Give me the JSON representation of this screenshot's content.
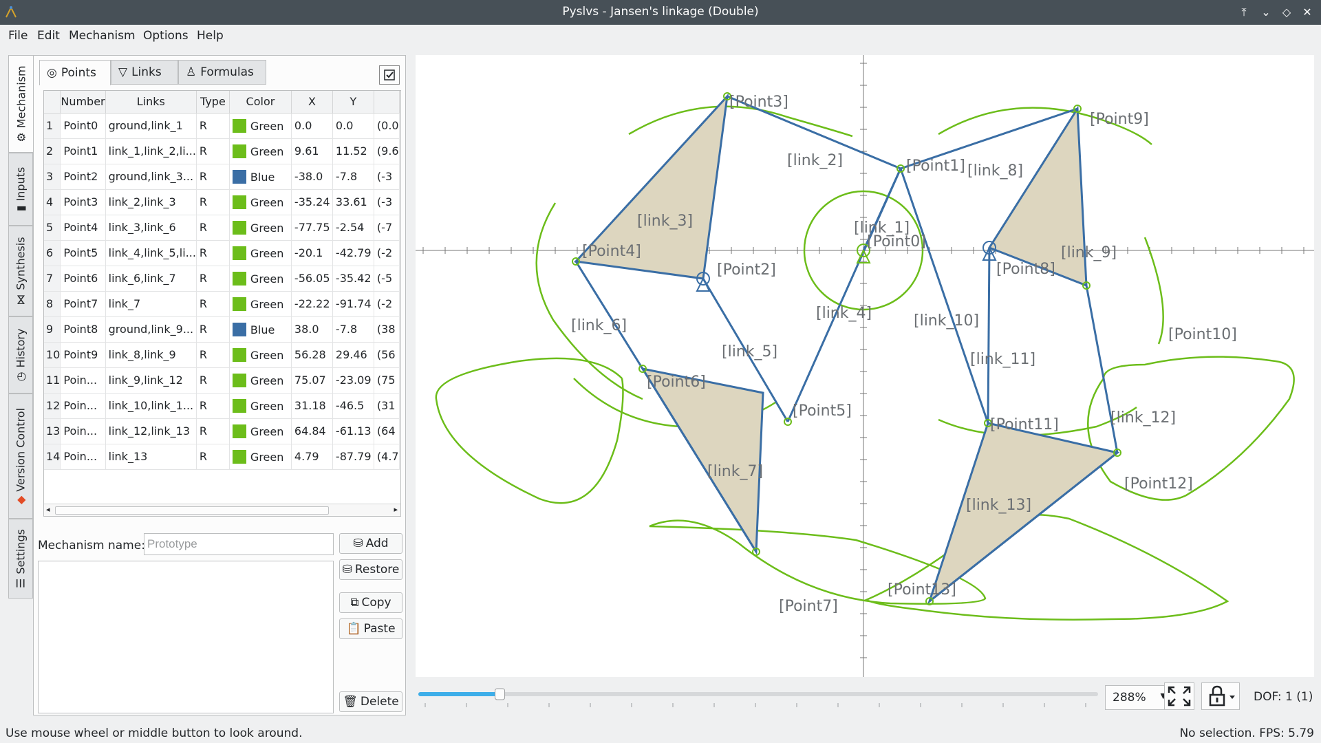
{
  "window": {
    "title": "Pyslvs - Jansen's linkage (Double)"
  },
  "menu": [
    {
      "label": "File"
    },
    {
      "label": "Edit"
    },
    {
      "label": "Mechanism"
    },
    {
      "label": "Options"
    },
    {
      "label": "Help"
    }
  ],
  "side_tabs": [
    "Mechanism",
    "Inputs",
    "Synthesis",
    "History",
    "Version Control",
    "Settings"
  ],
  "tabs": [
    "Points",
    "Links",
    "Formulas"
  ],
  "table": {
    "headers": [
      "Number",
      "Links",
      "Type",
      "Color",
      "X",
      "Y",
      ""
    ],
    "rows": [
      {
        "n": "1",
        "name": "Point0",
        "links": "ground,link_1",
        "type": "R",
        "color": "Green",
        "x": "0.0",
        "y": "0.0",
        "extra": "(0.0"
      },
      {
        "n": "2",
        "name": "Point1",
        "links": "link_1,link_2,li...",
        "type": "R",
        "color": "Green",
        "x": "9.61",
        "y": "11.52",
        "extra": "(9.6"
      },
      {
        "n": "3",
        "name": "Point2",
        "links": "ground,link_3...",
        "type": "R",
        "color": "Blue",
        "x": "-38.0",
        "y": "-7.8",
        "extra": "(-3"
      },
      {
        "n": "4",
        "name": "Point3",
        "links": "link_2,link_3",
        "type": "R",
        "color": "Green",
        "x": "-35.24",
        "y": "33.61",
        "extra": "(-3"
      },
      {
        "n": "5",
        "name": "Point4",
        "links": "link_3,link_6",
        "type": "R",
        "color": "Green",
        "x": "-77.75",
        "y": "-2.54",
        "extra": "(-7"
      },
      {
        "n": "6",
        "name": "Point5",
        "links": "link_4,link_5,li...",
        "type": "R",
        "color": "Green",
        "x": "-20.1",
        "y": "-42.79",
        "extra": "(-2"
      },
      {
        "n": "7",
        "name": "Point6",
        "links": "link_6,link_7",
        "type": "R",
        "color": "Green",
        "x": "-56.05",
        "y": "-35.42",
        "extra": "(-5"
      },
      {
        "n": "8",
        "name": "Point7",
        "links": "link_7",
        "type": "R",
        "color": "Green",
        "x": "-22.22",
        "y": "-91.74",
        "extra": "(-2"
      },
      {
        "n": "9",
        "name": "Point8",
        "links": "ground,link_9...",
        "type": "R",
        "color": "Blue",
        "x": "38.0",
        "y": "-7.8",
        "extra": "(38"
      },
      {
        "n": "10",
        "name": "Point9",
        "links": "link_8,link_9",
        "type": "R",
        "color": "Green",
        "x": "56.28",
        "y": "29.46",
        "extra": "(56"
      },
      {
        "n": "11",
        "name": "Poin...",
        "links": "link_9,link_12",
        "type": "R",
        "color": "Green",
        "x": "75.07",
        "y": "-23.09",
        "extra": "(75"
      },
      {
        "n": "12",
        "name": "Poin...",
        "links": "link_10,link_1...",
        "type": "R",
        "color": "Green",
        "x": "31.18",
        "y": "-46.5",
        "extra": "(31"
      },
      {
        "n": "13",
        "name": "Poin...",
        "links": "link_12,link_13",
        "type": "R",
        "color": "Green",
        "x": "64.84",
        "y": "-61.13",
        "extra": "(64"
      },
      {
        "n": "14",
        "name": "Poin...",
        "links": "link_13",
        "type": "R",
        "color": "Green",
        "x": "4.79",
        "y": "-87.79",
        "extra": "(4.7"
      }
    ]
  },
  "colors": {
    "Green": "#6cbd1a",
    "Blue": "#3a6ea5",
    "link": "#3a6ea5",
    "curve": "#6cbd1a",
    "fill": "#ddd6bf"
  },
  "mechanism_form": {
    "label": "Mechanism name:",
    "placeholder": "Prototype",
    "buttons": {
      "add": "Add",
      "restore": "Restore",
      "copy": "Copy",
      "paste": "Paste",
      "delete": "Delete"
    }
  },
  "canvas": {
    "point_labels": [
      "[Point0]",
      "[Point1]",
      "[Point2]",
      "[Point3]",
      "[Point4]",
      "[Point5]",
      "[Point6]",
      "[Point7]",
      "[Point8]",
      "[Point9]",
      "[Point10]",
      "[Point11]",
      "[Point12]",
      "[Point13]"
    ],
    "link_labels": [
      "[link_1]",
      "[link_2]",
      "[link_3]",
      "[link_4]",
      "[link_5]",
      "[link_6]",
      "[link_7]",
      "[link_8]",
      "[link_9]",
      "[link_10]",
      "[link_11]",
      "[link_12]",
      "[link_13]"
    ]
  },
  "bottom": {
    "zoom": "288%",
    "dof": "DOF:  1 (1)",
    "slider_progress": 0.12
  },
  "status": {
    "left": "Use mouse wheel or middle button to look around.",
    "right": "No selection.  FPS:   5.79"
  }
}
